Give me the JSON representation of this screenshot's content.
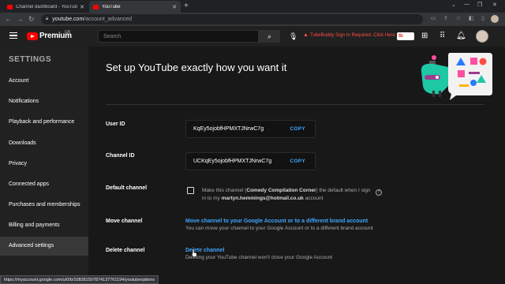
{
  "browser": {
    "tabs": [
      {
        "label": "Channel dashboard - YouTube Stu",
        "active": false
      },
      {
        "label": "YouTube",
        "active": true
      }
    ],
    "url_host": "youtube.com",
    "url_path": "/account_advanced",
    "status_url": "https://myaccount.google.com/u/0/b/108381507874137761194/youtubeoptions"
  },
  "header": {
    "brand": "Premium",
    "region": "GB",
    "search_placeholder": "Search",
    "warning": "TubeBuddy Sign In Required. Click Here",
    "tubebuddy_badge": "tb"
  },
  "sidebar": {
    "title": "SETTINGS",
    "items": [
      {
        "label": "Account"
      },
      {
        "label": "Notifications"
      },
      {
        "label": "Playback and performance"
      },
      {
        "label": "Downloads"
      },
      {
        "label": "Privacy"
      },
      {
        "label": "Connected apps"
      },
      {
        "label": "Purchases and memberships"
      },
      {
        "label": "Billing and payments"
      },
      {
        "label": "Advanced settings",
        "active": true
      }
    ]
  },
  "main": {
    "title": "Set up YouTube exactly how you want it",
    "user_id": {
      "label": "User ID",
      "value": "KqEy5ojobfHPMXTJNrwC7g",
      "copy": "COPY"
    },
    "channel_id": {
      "label": "Channel ID",
      "value": "UCKqEy5ojobfHPMXTJNrwC7g",
      "copy": "COPY"
    },
    "default_channel": {
      "label": "Default channel",
      "text_pre": "Make this channel (",
      "channel_name": "Comedy Compilation Corner",
      "text_mid": ") the default when I sign in to my ",
      "email": "martyn.hemmings@hotmail.co.uk",
      "text_post": " account",
      "help": "?"
    },
    "move_channel": {
      "label": "Move channel",
      "link": "Move channel to your Google Account or to a different brand account",
      "sub": "You can move your channel to your Google Account or to a different brand account"
    },
    "delete_channel": {
      "label": "Delete channel",
      "link": "Delete channel",
      "sub": "Deleting your YouTube channel won't close your Google Account"
    }
  },
  "colors": {
    "link": "#3ea6ff",
    "warning": "#ff4e45",
    "brand_red": "#ff0000"
  }
}
